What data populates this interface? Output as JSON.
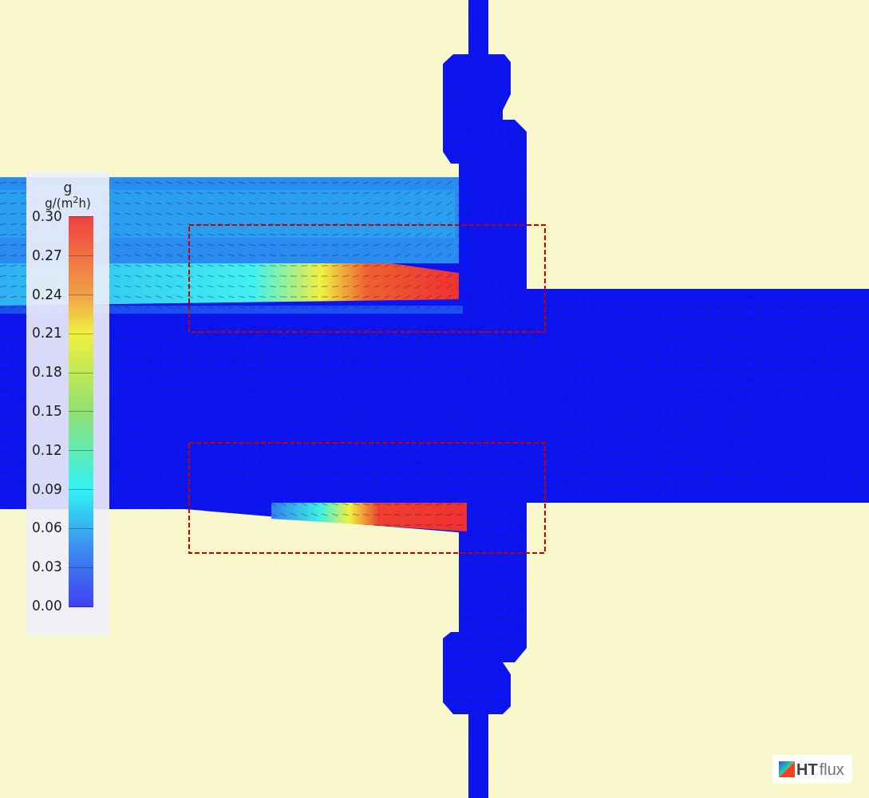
{
  "legend": {
    "quantity": "g",
    "unit": "g/(m$^{2}$h)",
    "ticks": [
      "0.30",
      "0.27",
      "0.24",
      "0.21",
      "0.18",
      "0.15",
      "0.12",
      "0.09",
      "0.06",
      "0.03",
      "0.00"
    ]
  },
  "logo": {
    "bold": "HT",
    "light": "flux"
  }
}
